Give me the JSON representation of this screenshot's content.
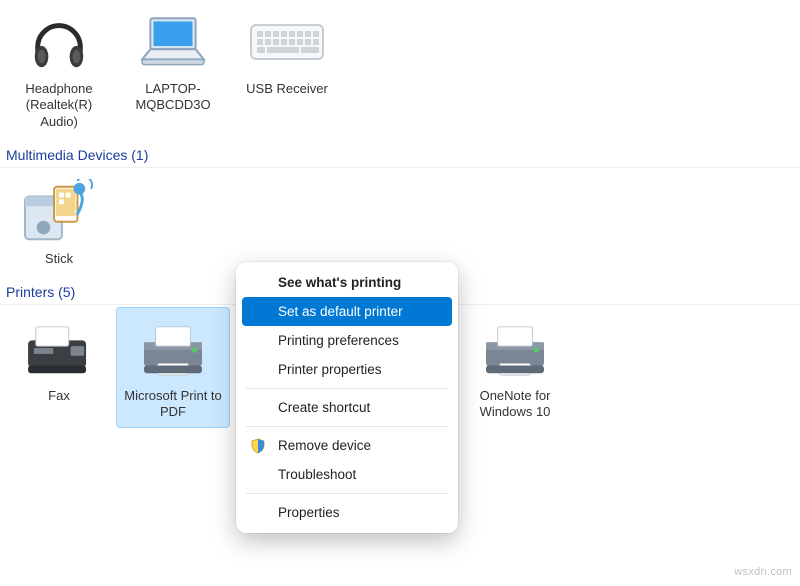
{
  "sections": {
    "devices": [
      {
        "label": "Headphone (Realtek(R) Audio)"
      },
      {
        "label": "LAPTOP-MQBCDD3O"
      },
      {
        "label": "USB Receiver"
      }
    ],
    "multimedia": {
      "title": "Multimedia Devices",
      "count": "(1)",
      "items": [
        {
          "label": "Stick"
        }
      ]
    },
    "printers": {
      "title": "Printers",
      "count": "(5)",
      "items": [
        {
          "label": "Fax"
        },
        {
          "label": "Microsoft Print to PDF",
          "selected": true
        },
        {
          "label": ""
        },
        {
          "label": ""
        },
        {
          "label": "OneNote for Windows 10"
        }
      ]
    }
  },
  "context_menu": {
    "see_whats_printing": "See what's printing",
    "set_default": "Set as default printer",
    "printing_prefs": "Printing preferences",
    "printer_props": "Printer properties",
    "create_shortcut": "Create shortcut",
    "remove_device": "Remove device",
    "troubleshoot": "Troubleshoot",
    "properties": "Properties"
  },
  "watermark": "wsxdn.com"
}
